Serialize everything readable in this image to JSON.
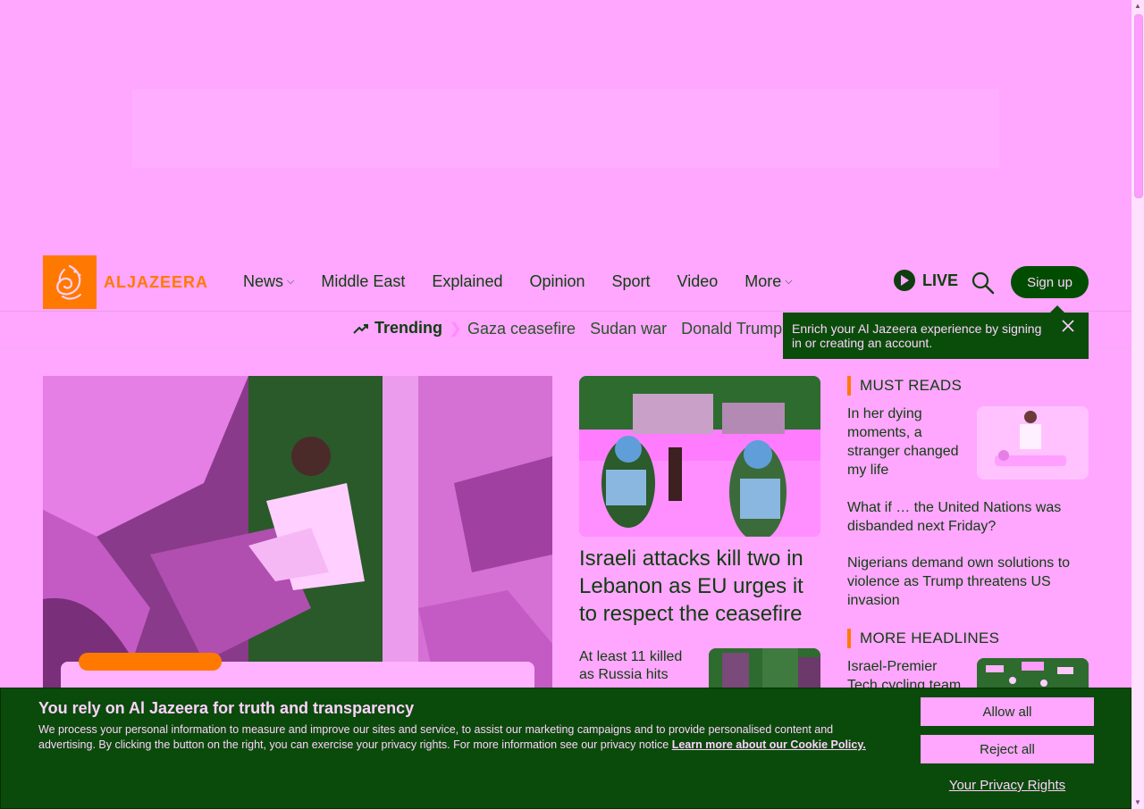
{
  "brand": {
    "name": "ALJAZEERA",
    "color": "#ff7900"
  },
  "nav": {
    "items": [
      {
        "label": "News",
        "has_dropdown": true
      },
      {
        "label": "Middle East",
        "has_dropdown": false
      },
      {
        "label": "Explained",
        "has_dropdown": false
      },
      {
        "label": "Opinion",
        "has_dropdown": false
      },
      {
        "label": "Sport",
        "has_dropdown": false
      },
      {
        "label": "Video",
        "has_dropdown": false
      },
      {
        "label": "More",
        "has_dropdown": true
      }
    ],
    "live_label": "LIVE",
    "signup_label": "Sign up"
  },
  "trending": {
    "label": "Trending",
    "items": [
      "Gaza ceasefire",
      "Sudan war",
      "Donald Trump"
    ]
  },
  "tooltip": {
    "text": "Enrich your Al Jazeera experience by signing in or creating an account."
  },
  "main": {
    "secondary_headline": "Israeli attacks kill two in Lebanon as EU urges it to respect the ceasefire",
    "small_headline": "At least 11 killed as Russia hits"
  },
  "must_reads": {
    "heading": "MUST READS",
    "items": [
      "In her dying moments, a stranger changed my life",
      "What if … the United Nations was disbanded next Friday?",
      "Nigerians demand own solutions to violence as Trump threatens US invasion"
    ]
  },
  "more_headlines": {
    "heading": "MORE HEADLINES",
    "items": [
      "Israel-Premier Tech cycling team"
    ]
  },
  "cookie": {
    "title": "You rely on Al Jazeera for truth and transparency",
    "text": "We process your personal information to measure and improve our sites and service, to assist our marketing campaigns and to provide personalised content and advertising. By clicking the button on the right, you can exercise your privacy rights. For more information see our privacy notice",
    "link": "Learn more about our Cookie Policy.",
    "allow_label": "Allow all",
    "reject_label": "Reject all",
    "privacy_label": "Your Privacy Rights"
  },
  "colors": {
    "background": "#ffa6ff",
    "dark_green": "#0a4a0a",
    "accent": "#ff7900"
  }
}
